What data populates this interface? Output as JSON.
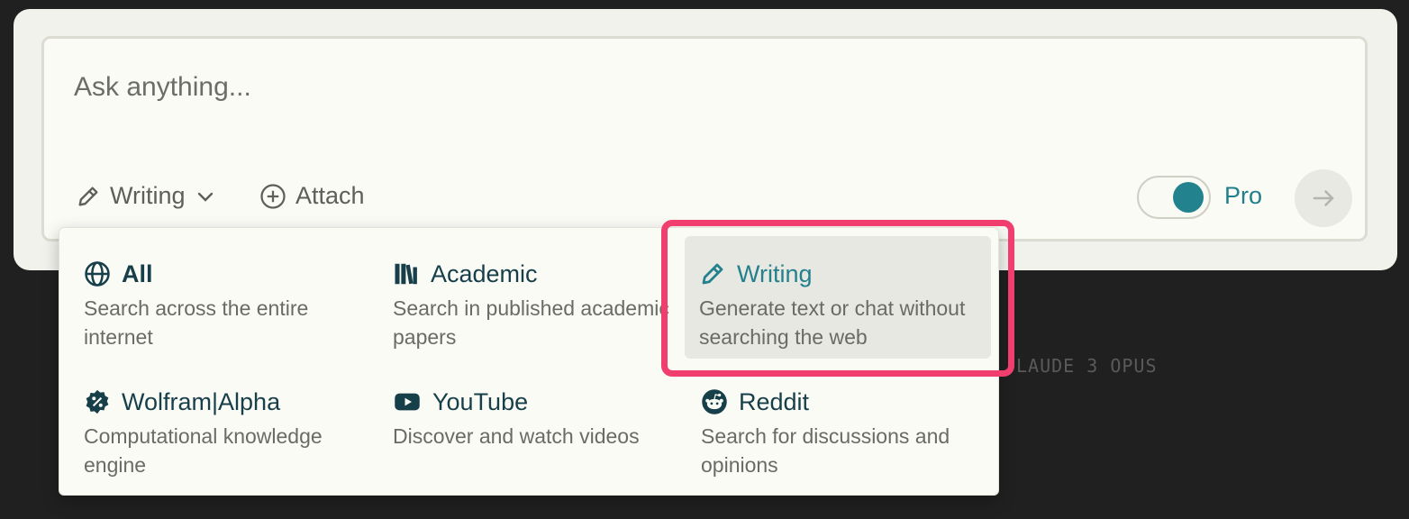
{
  "search": {
    "placeholder": "Ask anything...",
    "focus_label": "Writing",
    "attach_label": "Attach",
    "pro_label": "Pro",
    "pro_enabled": true
  },
  "focus_menu": {
    "items": [
      {
        "title": "All",
        "description": "Search across the entire internet",
        "icon": "globe-icon"
      },
      {
        "title": "Academic",
        "description": "Search in published academic papers",
        "icon": "books-icon"
      },
      {
        "title": "Writing",
        "description": "Generate text or chat without searching the web",
        "icon": "pencil-icon",
        "selected": true
      },
      {
        "title": "Wolfram|Alpha",
        "description": "Computational knowledge engine",
        "icon": "wolfram-icon"
      },
      {
        "title": "YouTube",
        "description": "Discover and watch videos",
        "icon": "youtube-icon"
      },
      {
        "title": "Reddit",
        "description": "Search for discussions and opinions",
        "icon": "reddit-icon"
      }
    ]
  },
  "background": {
    "model_label": "LAUDE 3 OPUS"
  },
  "colors": {
    "accent": "#22828e",
    "highlight": "#f03f6e",
    "backdrop": "#202020"
  }
}
